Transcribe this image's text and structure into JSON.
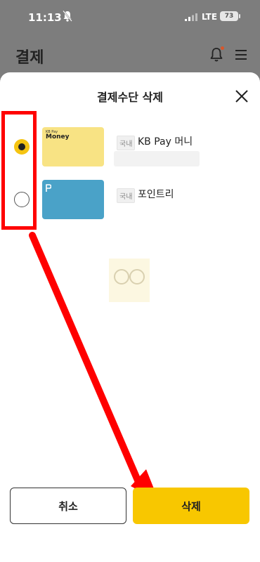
{
  "status_bar": {
    "time": "11:13",
    "network": "LTE",
    "battery": "73"
  },
  "app_header": {
    "title": "결제"
  },
  "sheet": {
    "title": "결제수단 삭제",
    "methods": [
      {
        "selected": true,
        "badge": "국내",
        "name": "KB Pay 머니",
        "card_subtitle": "KB Pay",
        "card_brand": "Money",
        "card_color": "#f8e384"
      },
      {
        "selected": false,
        "badge": "국내",
        "name": "포인트리",
        "card_color": "#4aa2c8"
      }
    ],
    "cancel_label": "취소",
    "delete_label": "삭제"
  },
  "colors": {
    "accent": "#f8c700",
    "annotation": "#ff0000"
  }
}
